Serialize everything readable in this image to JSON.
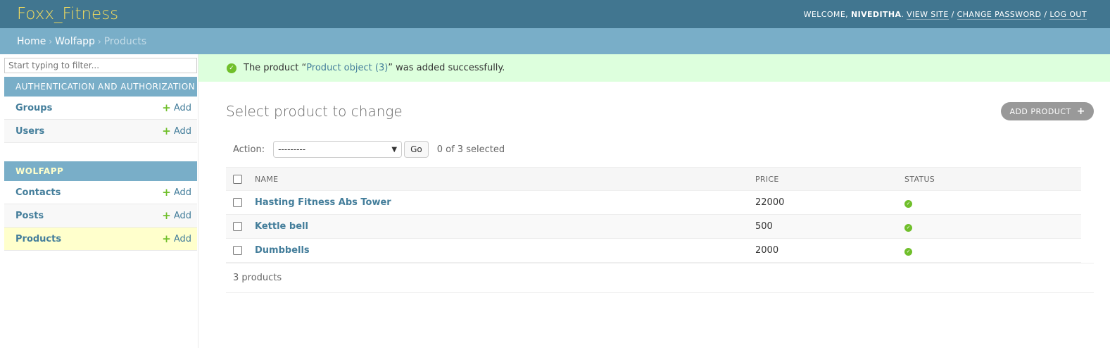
{
  "header": {
    "brand": "Foxx_Fitness",
    "welcome": "WELCOME,",
    "username": "NIVEDITHA",
    "view_site": "VIEW SITE",
    "change_password": "CHANGE PASSWORD",
    "log_out": "LOG OUT",
    "separator": "/"
  },
  "breadcrumbs": {
    "home": "Home",
    "app": "Wolfapp",
    "current": "Products",
    "sep": "›"
  },
  "sidebar": {
    "filter_placeholder": "Start typing to filter...",
    "auth": {
      "caption": "Authentication and Authorization",
      "items": [
        {
          "label": "Groups",
          "add": "Add"
        },
        {
          "label": "Users",
          "add": "Add"
        }
      ]
    },
    "wolfapp": {
      "caption": "Wolfapp",
      "items": [
        {
          "label": "Contacts",
          "add": "Add"
        },
        {
          "label": "Posts",
          "add": "Add"
        },
        {
          "label": "Products",
          "add": "Add"
        }
      ]
    }
  },
  "message": {
    "prefix": "The product “",
    "link": "Product object (3)",
    "suffix": "” was added successfully."
  },
  "page": {
    "title": "Select product to change",
    "add_button": "Add product"
  },
  "actions": {
    "label": "Action:",
    "selected_value": "---------",
    "go": "Go",
    "counter": "0 of 3 selected"
  },
  "table": {
    "headers": {
      "name": "Name",
      "price": "Price",
      "status": "Status"
    },
    "rows": [
      {
        "name": "Hasting Fitness Abs Tower",
        "price": "22000",
        "status": "yes"
      },
      {
        "name": "Kettle bell",
        "price": "500",
        "status": "yes"
      },
      {
        "name": "Dumbbells",
        "price": "2000",
        "status": "yes"
      }
    ]
  },
  "paginator": "3 products",
  "colors": {
    "header_bg": "#417690",
    "breadcrumbs_bg": "#79aec8",
    "brand": "#f5dd5d",
    "success_bg": "#ddffdd",
    "link": "#447e9b",
    "accent_green": "#70bf2b"
  }
}
